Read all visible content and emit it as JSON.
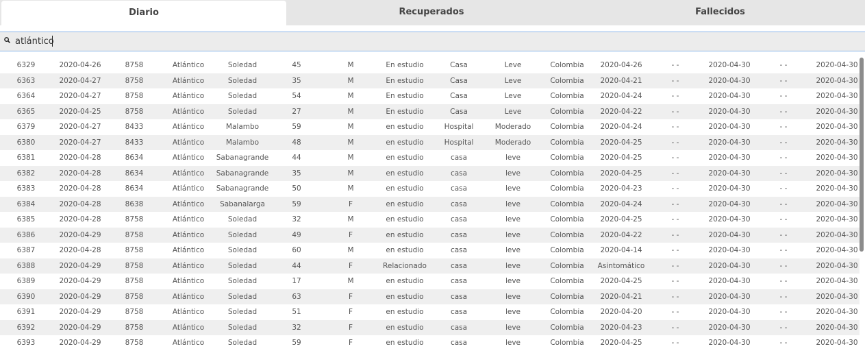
{
  "tabs": [
    {
      "label": "Diario",
      "active": true
    },
    {
      "label": "Recuperados",
      "active": false
    },
    {
      "label": "Fallecidos",
      "active": false
    }
  ],
  "search": {
    "value": "atlántico",
    "icon": "search-icon"
  },
  "colors": {
    "tab_bar": "#e6e6e6",
    "focus_border": "#88b4e8",
    "row_alt": "#efefef",
    "scrollbar": "#8c8c8c"
  },
  "rows": [
    [
      "6329",
      "2020-04-26",
      "8758",
      "Atlántico",
      "Soledad",
      "45",
      "M",
      "En estudio",
      "Casa",
      "Leve",
      "Colombia",
      "2020-04-26",
      "- -",
      "2020-04-30",
      "- -",
      "2020-04-30"
    ],
    [
      "6363",
      "2020-04-27",
      "8758",
      "Atlántico",
      "Soledad",
      "35",
      "M",
      "En estudio",
      "Casa",
      "Leve",
      "Colombia",
      "2020-04-21",
      "- -",
      "2020-04-30",
      "- -",
      "2020-04-30"
    ],
    [
      "6364",
      "2020-04-27",
      "8758",
      "Atlántico",
      "Soledad",
      "54",
      "M",
      "En estudio",
      "Casa",
      "Leve",
      "Colombia",
      "2020-04-24",
      "- -",
      "2020-04-30",
      "- -",
      "2020-04-30"
    ],
    [
      "6365",
      "2020-04-25",
      "8758",
      "Atlántico",
      "Soledad",
      "27",
      "M",
      "En estudio",
      "Casa",
      "Leve",
      "Colombia",
      "2020-04-22",
      "- -",
      "2020-04-30",
      "- -",
      "2020-04-30"
    ],
    [
      "6379",
      "2020-04-27",
      "8433",
      "Atlántico",
      "Malambo",
      "59",
      "M",
      "en estudio",
      "Hospital",
      "Moderado",
      "Colombia",
      "2020-04-24",
      "- -",
      "2020-04-30",
      "- -",
      "2020-04-30"
    ],
    [
      "6380",
      "2020-04-27",
      "8433",
      "Atlántico",
      "Malambo",
      "48",
      "M",
      "en estudio",
      "Hospital",
      "Moderado",
      "Colombia",
      "2020-04-25",
      "- -",
      "2020-04-30",
      "- -",
      "2020-04-30"
    ],
    [
      "6381",
      "2020-04-28",
      "8634",
      "Atlántico",
      "Sabanagrande",
      "44",
      "M",
      "en estudio",
      "casa",
      "leve",
      "Colombia",
      "2020-04-25",
      "- -",
      "2020-04-30",
      "- -",
      "2020-04-30"
    ],
    [
      "6382",
      "2020-04-28",
      "8634",
      "Atlántico",
      "Sabanagrande",
      "35",
      "M",
      "en estudio",
      "casa",
      "leve",
      "Colombia",
      "2020-04-25",
      "- -",
      "2020-04-30",
      "- -",
      "2020-04-30"
    ],
    [
      "6383",
      "2020-04-28",
      "8634",
      "Atlántico",
      "Sabanagrande",
      "50",
      "M",
      "en estudio",
      "casa",
      "leve",
      "Colombia",
      "2020-04-23",
      "- -",
      "2020-04-30",
      "- -",
      "2020-04-30"
    ],
    [
      "6384",
      "2020-04-28",
      "8638",
      "Atlántico",
      "Sabanalarga",
      "59",
      "F",
      "en estudio",
      "casa",
      "leve",
      "Colombia",
      "2020-04-24",
      "- -",
      "2020-04-30",
      "- -",
      "2020-04-30"
    ],
    [
      "6385",
      "2020-04-28",
      "8758",
      "Atlántico",
      "Soledad",
      "32",
      "M",
      "en estudio",
      "casa",
      "leve",
      "Colombia",
      "2020-04-25",
      "- -",
      "2020-04-30",
      "- -",
      "2020-04-30"
    ],
    [
      "6386",
      "2020-04-29",
      "8758",
      "Atlántico",
      "Soledad",
      "49",
      "F",
      "en estudio",
      "casa",
      "leve",
      "Colombia",
      "2020-04-22",
      "- -",
      "2020-04-30",
      "- -",
      "2020-04-30"
    ],
    [
      "6387",
      "2020-04-28",
      "8758",
      "Atlántico",
      "Soledad",
      "60",
      "M",
      "en estudio",
      "casa",
      "leve",
      "Colombia",
      "2020-04-14",
      "- -",
      "2020-04-30",
      "- -",
      "2020-04-30"
    ],
    [
      "6388",
      "2020-04-29",
      "8758",
      "Atlántico",
      "Soledad",
      "44",
      "F",
      "Relacionado",
      "casa",
      "leve",
      "Colombia",
      "Asintomático",
      "- -",
      "2020-04-30",
      "- -",
      "2020-04-30"
    ],
    [
      "6389",
      "2020-04-29",
      "8758",
      "Atlántico",
      "Soledad",
      "17",
      "M",
      "en estudio",
      "casa",
      "leve",
      "Colombia",
      "2020-04-25",
      "- -",
      "2020-04-30",
      "- -",
      "2020-04-30"
    ],
    [
      "6390",
      "2020-04-29",
      "8758",
      "Atlántico",
      "Soledad",
      "63",
      "F",
      "en estudio",
      "casa",
      "leve",
      "Colombia",
      "2020-04-21",
      "- -",
      "2020-04-30",
      "- -",
      "2020-04-30"
    ],
    [
      "6391",
      "2020-04-29",
      "8758",
      "Atlántico",
      "Soledad",
      "51",
      "F",
      "en estudio",
      "casa",
      "leve",
      "Colombia",
      "2020-04-20",
      "- -",
      "2020-04-30",
      "- -",
      "2020-04-30"
    ],
    [
      "6392",
      "2020-04-29",
      "8758",
      "Atlántico",
      "Soledad",
      "32",
      "F",
      "en estudio",
      "casa",
      "leve",
      "Colombia",
      "2020-04-23",
      "- -",
      "2020-04-30",
      "- -",
      "2020-04-30"
    ],
    [
      "6393",
      "2020-04-29",
      "8758",
      "Atlántico",
      "Soledad",
      "59",
      "F",
      "en estudio",
      "casa",
      "leve",
      "Colombia",
      "2020-04-25",
      "- -",
      "2020-04-30",
      "- -",
      "2020-04-30"
    ]
  ]
}
